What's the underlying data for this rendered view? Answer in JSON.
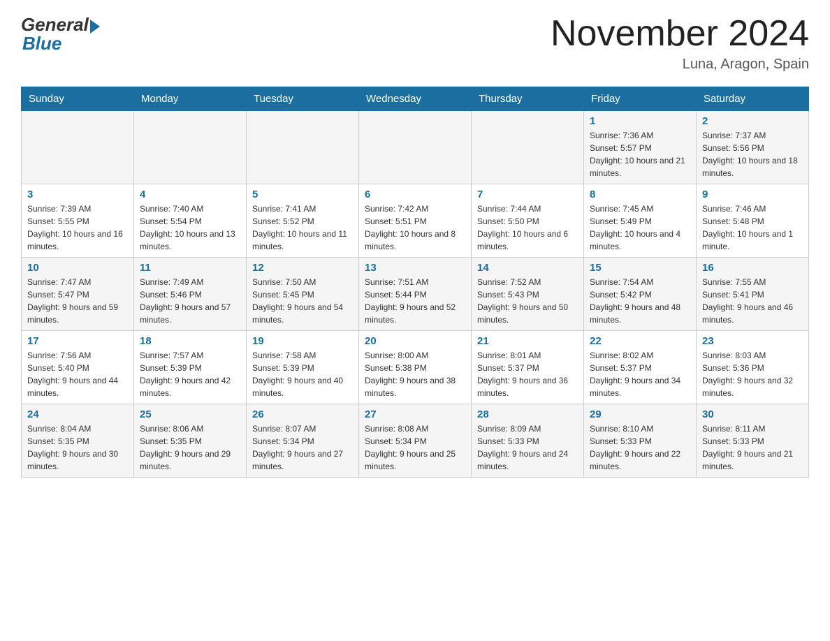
{
  "header": {
    "logo_general": "General",
    "logo_blue": "Blue",
    "month_title": "November 2024",
    "location": "Luna, Aragon, Spain"
  },
  "weekdays": [
    "Sunday",
    "Monday",
    "Tuesday",
    "Wednesday",
    "Thursday",
    "Friday",
    "Saturday"
  ],
  "weeks": [
    [
      {
        "day": "",
        "info": ""
      },
      {
        "day": "",
        "info": ""
      },
      {
        "day": "",
        "info": ""
      },
      {
        "day": "",
        "info": ""
      },
      {
        "day": "",
        "info": ""
      },
      {
        "day": "1",
        "info": "Sunrise: 7:36 AM\nSunset: 5:57 PM\nDaylight: 10 hours and 21 minutes."
      },
      {
        "day": "2",
        "info": "Sunrise: 7:37 AM\nSunset: 5:56 PM\nDaylight: 10 hours and 18 minutes."
      }
    ],
    [
      {
        "day": "3",
        "info": "Sunrise: 7:39 AM\nSunset: 5:55 PM\nDaylight: 10 hours and 16 minutes."
      },
      {
        "day": "4",
        "info": "Sunrise: 7:40 AM\nSunset: 5:54 PM\nDaylight: 10 hours and 13 minutes."
      },
      {
        "day": "5",
        "info": "Sunrise: 7:41 AM\nSunset: 5:52 PM\nDaylight: 10 hours and 11 minutes."
      },
      {
        "day": "6",
        "info": "Sunrise: 7:42 AM\nSunset: 5:51 PM\nDaylight: 10 hours and 8 minutes."
      },
      {
        "day": "7",
        "info": "Sunrise: 7:44 AM\nSunset: 5:50 PM\nDaylight: 10 hours and 6 minutes."
      },
      {
        "day": "8",
        "info": "Sunrise: 7:45 AM\nSunset: 5:49 PM\nDaylight: 10 hours and 4 minutes."
      },
      {
        "day": "9",
        "info": "Sunrise: 7:46 AM\nSunset: 5:48 PM\nDaylight: 10 hours and 1 minute."
      }
    ],
    [
      {
        "day": "10",
        "info": "Sunrise: 7:47 AM\nSunset: 5:47 PM\nDaylight: 9 hours and 59 minutes."
      },
      {
        "day": "11",
        "info": "Sunrise: 7:49 AM\nSunset: 5:46 PM\nDaylight: 9 hours and 57 minutes."
      },
      {
        "day": "12",
        "info": "Sunrise: 7:50 AM\nSunset: 5:45 PM\nDaylight: 9 hours and 54 minutes."
      },
      {
        "day": "13",
        "info": "Sunrise: 7:51 AM\nSunset: 5:44 PM\nDaylight: 9 hours and 52 minutes."
      },
      {
        "day": "14",
        "info": "Sunrise: 7:52 AM\nSunset: 5:43 PM\nDaylight: 9 hours and 50 minutes."
      },
      {
        "day": "15",
        "info": "Sunrise: 7:54 AM\nSunset: 5:42 PM\nDaylight: 9 hours and 48 minutes."
      },
      {
        "day": "16",
        "info": "Sunrise: 7:55 AM\nSunset: 5:41 PM\nDaylight: 9 hours and 46 minutes."
      }
    ],
    [
      {
        "day": "17",
        "info": "Sunrise: 7:56 AM\nSunset: 5:40 PM\nDaylight: 9 hours and 44 minutes."
      },
      {
        "day": "18",
        "info": "Sunrise: 7:57 AM\nSunset: 5:39 PM\nDaylight: 9 hours and 42 minutes."
      },
      {
        "day": "19",
        "info": "Sunrise: 7:58 AM\nSunset: 5:39 PM\nDaylight: 9 hours and 40 minutes."
      },
      {
        "day": "20",
        "info": "Sunrise: 8:00 AM\nSunset: 5:38 PM\nDaylight: 9 hours and 38 minutes."
      },
      {
        "day": "21",
        "info": "Sunrise: 8:01 AM\nSunset: 5:37 PM\nDaylight: 9 hours and 36 minutes."
      },
      {
        "day": "22",
        "info": "Sunrise: 8:02 AM\nSunset: 5:37 PM\nDaylight: 9 hours and 34 minutes."
      },
      {
        "day": "23",
        "info": "Sunrise: 8:03 AM\nSunset: 5:36 PM\nDaylight: 9 hours and 32 minutes."
      }
    ],
    [
      {
        "day": "24",
        "info": "Sunrise: 8:04 AM\nSunset: 5:35 PM\nDaylight: 9 hours and 30 minutes."
      },
      {
        "day": "25",
        "info": "Sunrise: 8:06 AM\nSunset: 5:35 PM\nDaylight: 9 hours and 29 minutes."
      },
      {
        "day": "26",
        "info": "Sunrise: 8:07 AM\nSunset: 5:34 PM\nDaylight: 9 hours and 27 minutes."
      },
      {
        "day": "27",
        "info": "Sunrise: 8:08 AM\nSunset: 5:34 PM\nDaylight: 9 hours and 25 minutes."
      },
      {
        "day": "28",
        "info": "Sunrise: 8:09 AM\nSunset: 5:33 PM\nDaylight: 9 hours and 24 minutes."
      },
      {
        "day": "29",
        "info": "Sunrise: 8:10 AM\nSunset: 5:33 PM\nDaylight: 9 hours and 22 minutes."
      },
      {
        "day": "30",
        "info": "Sunrise: 8:11 AM\nSunset: 5:33 PM\nDaylight: 9 hours and 21 minutes."
      }
    ]
  ]
}
